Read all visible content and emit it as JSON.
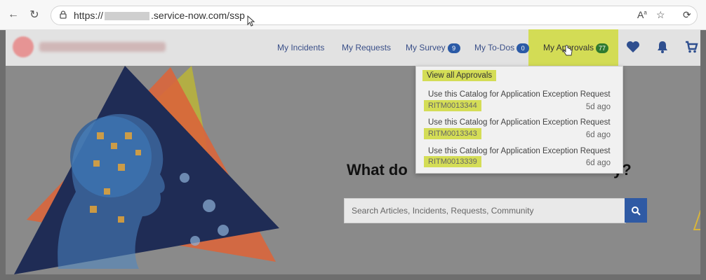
{
  "browser": {
    "url_prefix": "https://",
    "url_suffix": ".service-now.com/ssp",
    "icons": [
      "back-arrow-icon",
      "refresh-icon",
      "lock-icon",
      "read-aloud-icon",
      "favorite-star-icon",
      "extensions-icon"
    ]
  },
  "header": {
    "links": [
      {
        "label": "My Incidents"
      },
      {
        "label": "My Requests"
      },
      {
        "label": "My Survey",
        "badge": "9"
      },
      {
        "label": "My To-Dos",
        "badge": "0"
      },
      {
        "label": "My Approvals",
        "badge": "77"
      }
    ],
    "icons": [
      "heart-icon",
      "bell-icon",
      "cart-icon"
    ]
  },
  "approvals_dropdown": {
    "view_all": "View all Approvals",
    "items": [
      {
        "title": "Use this Catalog for Application Exception Request",
        "number": "RITM0013344",
        "age": "5d ago"
      },
      {
        "title": "Use this Catalog for Application Exception Request",
        "number": "RITM0013343",
        "age": "6d ago"
      },
      {
        "title": "Use this Catalog for Application Exception Request",
        "number": "RITM0013339",
        "age": "6d ago"
      }
    ]
  },
  "hero": {
    "question_left": "What do",
    "question_right": "y?",
    "search_placeholder": "Search Articles, Incidents, Requests, Community"
  },
  "colors": {
    "highlight": "#d4dd56",
    "nav_text": "#3a4f88",
    "search_button": "#2f5aa4"
  }
}
